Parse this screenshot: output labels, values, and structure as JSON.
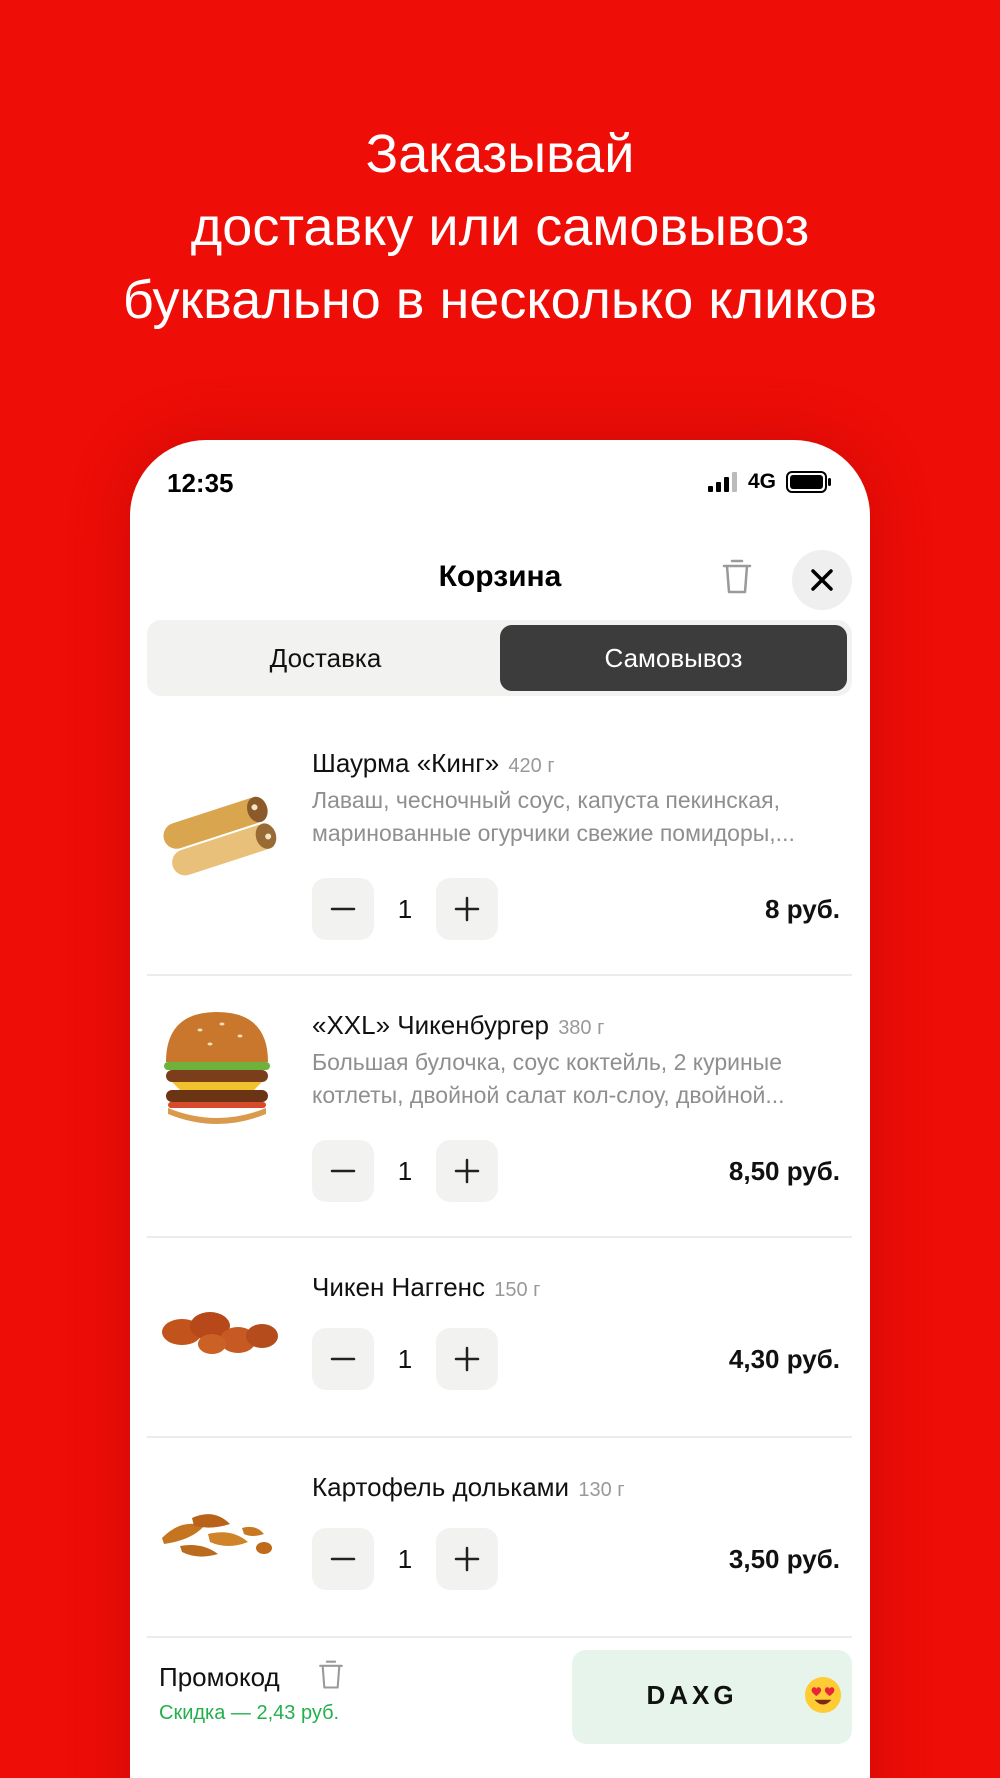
{
  "headline": {
    "line1": "Заказывай",
    "line2": "доставку или самовывоз",
    "line3": "буквально в несколько кликов"
  },
  "status_bar": {
    "time": "12:35",
    "network": "4G"
  },
  "cart": {
    "title": "Корзина",
    "tabs": [
      {
        "label": "Доставка",
        "selected": false
      },
      {
        "label": "Самовывоз",
        "selected": true
      }
    ],
    "items": [
      {
        "name": "Шаурма «Кинг»",
        "weight": "420 г",
        "desc_line1": "Лаваш, чесночный соус, капуста пекинская,",
        "desc_line2": "маринованные огурчики свежие помидоры,...",
        "qty": "1",
        "price": "8 руб."
      },
      {
        "name": "«XXL» Чикенбургер",
        "weight": "380 г",
        "desc_line1": "Большая булочка, соус коктейль, 2 куриные",
        "desc_line2": "котлеты, двойной салат кол-слоу, двойной...",
        "qty": "1",
        "price": "8,50 руб."
      },
      {
        "name": "Чикен Наггенс",
        "weight": "150 г",
        "qty": "1",
        "price": "4,30 руб."
      },
      {
        "name": "Картофель дольками",
        "weight": "130 г",
        "qty": "1",
        "price": "3,50 руб."
      }
    ],
    "promo": {
      "label": "Промокод",
      "discount": "Скидка — 2,43 руб.",
      "code": "DAXG"
    }
  },
  "colors": {
    "background": "#ee0d07",
    "segment_active": "#3c3c3c",
    "discount_text": "#23b04b",
    "promo_code_bg": "#e6f4ec"
  },
  "icons": [
    "signal-icon",
    "battery-icon",
    "trash-icon",
    "close-icon",
    "minus-icon",
    "plus-icon",
    "heart-eyes-emoji-icon"
  ]
}
